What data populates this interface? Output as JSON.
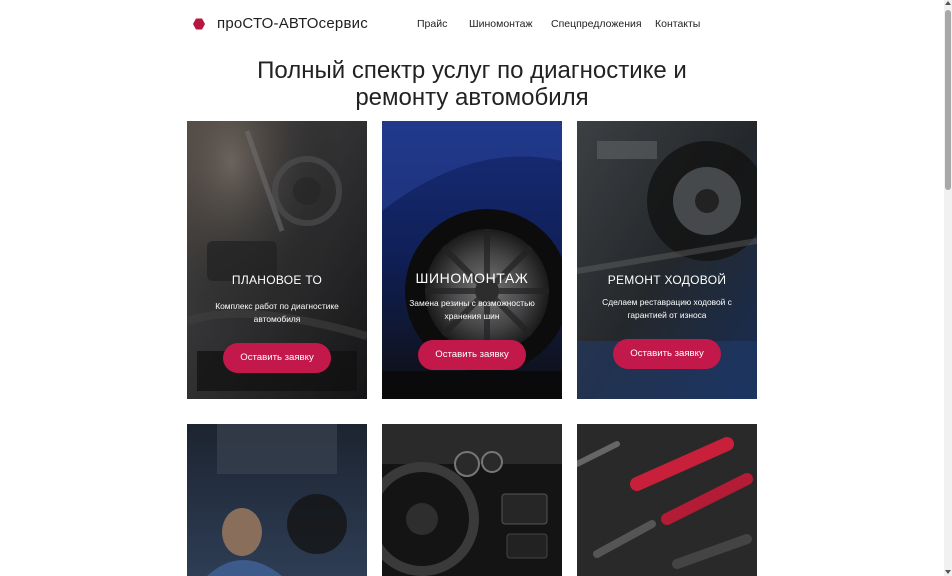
{
  "header": {
    "logo_text": "проСТО-АВТОсервис",
    "nav": [
      "Прайс",
      "Шиномонтаж",
      "Спецпредложения",
      "Контакты"
    ]
  },
  "main": {
    "title": "Полный спектр услуг по диагностике и ремонту автомобиля",
    "cards": [
      {
        "title": "ПЛАНОВОЕ ТО",
        "description": "Комплекс работ по диагностике автомобиля",
        "button": "Оставить заявку"
      },
      {
        "title": "ШИНОМОНТАЖ",
        "description": "Замена резины с возможностью хранения шин",
        "button": "Оставить заявку"
      },
      {
        "title": "РЕМОНТ ХОДОВОЙ",
        "description": "Сделаем реставрацию ходовой с гарантией от износа",
        "button": "Оставить заявку"
      }
    ]
  },
  "colors": {
    "accent": "#c2184a",
    "logo": "#b5173f"
  },
  "icons": {
    "logo": "hexagon-logo-icon"
  }
}
